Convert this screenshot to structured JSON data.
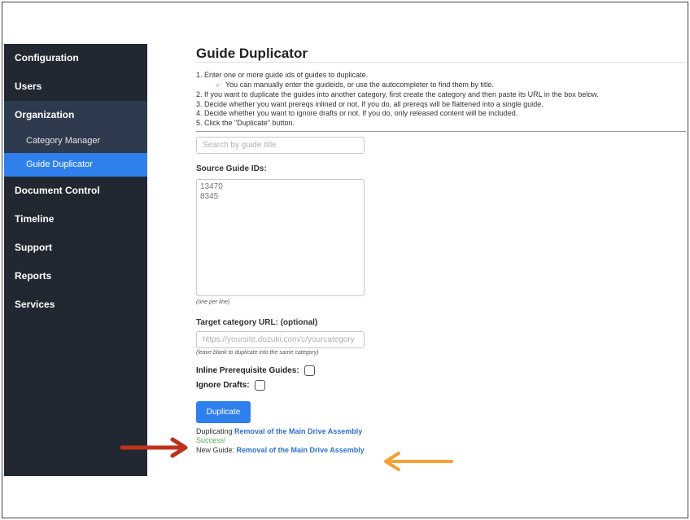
{
  "sidebar": {
    "items": [
      {
        "label": "Configuration"
      },
      {
        "label": "Users"
      },
      {
        "label": "Organization"
      },
      {
        "label": "Category Manager"
      },
      {
        "label": "Guide Duplicator"
      },
      {
        "label": "Document Control"
      },
      {
        "label": "Timeline"
      },
      {
        "label": "Support"
      },
      {
        "label": "Reports"
      },
      {
        "label": "Services"
      }
    ]
  },
  "main": {
    "title": "Guide Duplicator",
    "instructions": {
      "step1": "1. Enter one or more guide ids of guides to duplicate.",
      "step1_sub": "You can manually enter the guideids, or use the autocompleter to find them by title.",
      "step2": "2. If you want to duplicate the guides into another category, first create the category and then paste its URL in the box below.",
      "step3": "3. Decide whether you want prereqs inlined or not. If you do, all prereqs will be flattened into a single guide.",
      "step4": "4. Decide whether you want to ignore drafts or not. If you do, only released content will be included.",
      "step5": "5. Click the \"Duplicate\" button."
    },
    "search": {
      "placeholder": "Search by guide title"
    },
    "source_ids": {
      "label": "Source Guide IDs:",
      "placeholder": "13470\n8345",
      "hint": "(one per line)"
    },
    "target_category": {
      "label": "Target category URL: (optional)",
      "placeholder": "https://yoursite.dozuki.com/c/yourcategory",
      "hint": "(leave blank to duplicate into the same category)"
    },
    "inline_prereqs": {
      "label": "Inline Prerequisite Guides:"
    },
    "ignore_drafts": {
      "label": "Ignore Drafts:"
    },
    "duplicate_button": "Duplicate",
    "result": {
      "duplicating_prefix": "Duplicating",
      "duplicating_link": "Removal of the Main Drive Assembly",
      "success": "Success!",
      "new_guide_prefix": "New Guide:",
      "new_guide_link": "Removal of the Main Drive Assembly"
    }
  },
  "colors": {
    "sidebar_bg": "#222831",
    "selected_bg": "#2f80ed",
    "link": "#2f6fd0",
    "success": "#4caf50",
    "red_arrow": "#c0311a",
    "orange_arrow": "#f5a033"
  }
}
